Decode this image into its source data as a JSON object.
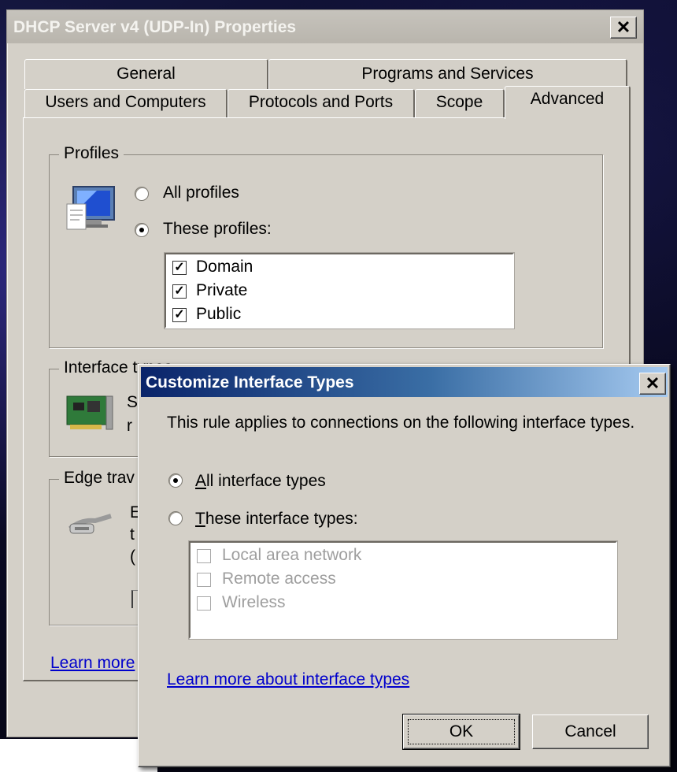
{
  "window": {
    "title": "DHCP Server v4 (UDP-In) Properties",
    "close_glyph": "✕",
    "tabs_row1": [
      "General",
      "Programs and Services"
    ],
    "tabs_row2": [
      "Users and Computers",
      "Protocols and Ports",
      "Scope",
      "Advanced"
    ],
    "active_tab": "Advanced",
    "profiles": {
      "label": "Profiles",
      "all_profiles": "All profiles",
      "these_profiles": "These profiles:",
      "selected": "These profiles:",
      "items": [
        {
          "label": "Domain",
          "checked": true
        },
        {
          "label": "Private",
          "checked": true
        },
        {
          "label": "Public",
          "checked": true
        }
      ]
    },
    "interface_types": {
      "label": "Interface types",
      "partial_text": [
        "S",
        "r"
      ]
    },
    "edge_traversal": {
      "label": "Edge trav",
      "partial_text": [
        "E",
        "t",
        "("
      ]
    },
    "learn_more_partial": "Learn more"
  },
  "dialog": {
    "title": "Customize Interface Types",
    "close_glyph": "✕",
    "description": "This rule applies to connections on the following interface types.",
    "option_all": {
      "underline": "A",
      "rest": "ll interface types"
    },
    "option_these": {
      "underline": "T",
      "rest": "hese interface types:"
    },
    "selected_option": "All interface types",
    "interface_items": [
      {
        "label": "Local area network",
        "checked": false,
        "enabled": false
      },
      {
        "label": "Remote access",
        "checked": false,
        "enabled": false
      },
      {
        "label": "Wireless",
        "checked": false,
        "enabled": false
      }
    ],
    "learn_more_link": "Learn more about interface types",
    "ok_label": "OK",
    "cancel_label": "Cancel"
  },
  "icons": [
    "monitor-profile-icon",
    "network-card-icon",
    "cable-plug-icon"
  ]
}
